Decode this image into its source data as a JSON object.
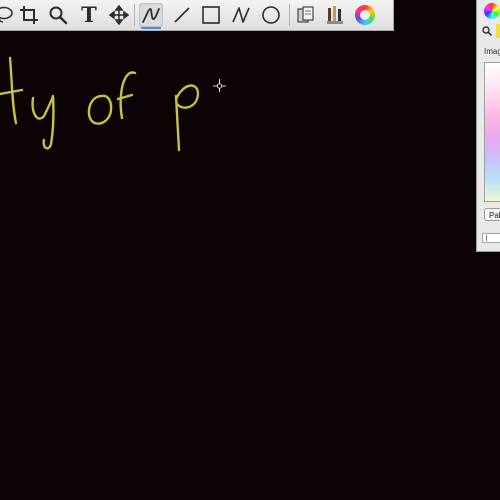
{
  "toolbar": {
    "tools": [
      {
        "name": "lasso-tool",
        "icon": "lasso-icon"
      },
      {
        "name": "crop-tool",
        "icon": "crop-icon"
      },
      {
        "name": "zoom-tool",
        "icon": "magnifier-icon"
      },
      {
        "name": "text-tool",
        "icon": "text-icon",
        "glyph": "T"
      },
      {
        "name": "move-tool",
        "icon": "move-arrows-icon"
      },
      {
        "name": "pen-tool",
        "icon": "pen-stroke-icon",
        "selected": true
      },
      {
        "name": "line-tool",
        "icon": "line-icon"
      },
      {
        "name": "rectangle-tool",
        "icon": "rectangle-icon"
      },
      {
        "name": "curve-tool",
        "icon": "curve-icon"
      },
      {
        "name": "ellipse-tool",
        "icon": "ellipse-icon"
      },
      {
        "name": "clone-tool",
        "icon": "clone-icon"
      },
      {
        "name": "brushes-tool",
        "icon": "brushes-icon"
      },
      {
        "name": "color-wheel-tool",
        "icon": "color-wheel-icon"
      }
    ]
  },
  "color_panel": {
    "image_label": "Imag",
    "palettes_label": "Pal",
    "selected_color": "#f2e04a"
  },
  "canvas": {
    "background": "#0a0203",
    "handwriting": "ty of p",
    "stroke_color": "#c9c23f",
    "cursor": "crosshair-icon"
  }
}
